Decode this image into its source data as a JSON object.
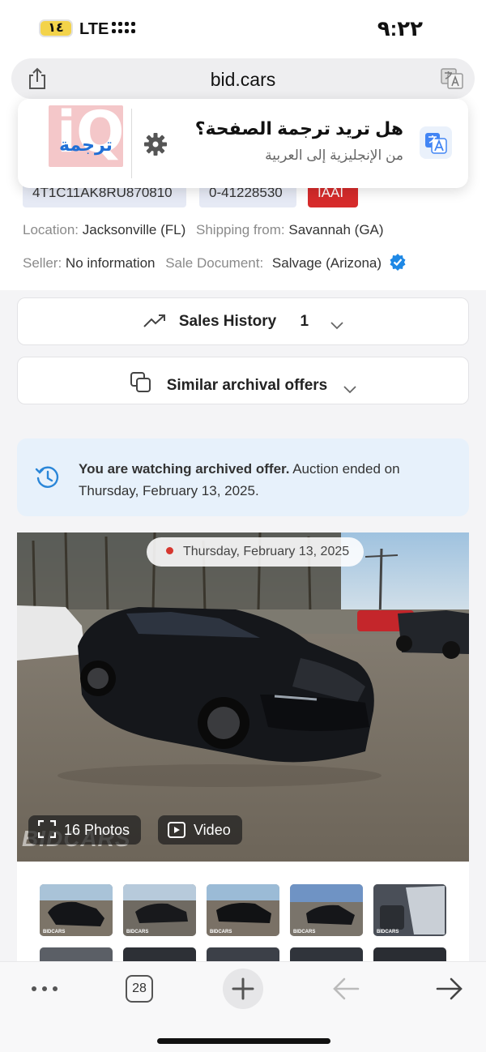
{
  "status_bar": {
    "battery_level": "١٤",
    "network": "LTE",
    "time": "٩:٢٢"
  },
  "browser": {
    "url": "bid.cars",
    "tab_count": "28"
  },
  "translate_banner": {
    "logo_text": "ترجمة",
    "prompt": "هل تريد ترجمة الصفحة؟",
    "language_pair": "من الإنجليزية إلى العربية"
  },
  "vehicle": {
    "vin": "4T1C11AK8RU870810",
    "lot": "0-41228530",
    "auction": "IAAI",
    "location_label": "Location:",
    "location": "Jacksonville (FL)",
    "shipping_label": "Shipping from:",
    "shipping": "Savannah (GA)",
    "seller_label": "Seller:",
    "seller": "No information",
    "document_label": "Sale Document:",
    "document": "Salvage (Arizona)"
  },
  "sections": {
    "sales_history_label": "Sales History",
    "sales_history_count": "1",
    "similar_label": "Similar archival offers"
  },
  "notice": {
    "bold": "You are watching archived offer.",
    "rest": " Auction ended on Thursday, February 13, 2025."
  },
  "gallery": {
    "date": "Thursday, February 13, 2025",
    "photos_label": "16 Photos",
    "video_label": "Video",
    "watermark": "BIDCARS",
    "thumb_label": "BIDCARS"
  },
  "colors": {
    "accent_blue": "#1a73e8",
    "auction_red": "#d62b2b",
    "notice_bg": "#e7f1fb"
  }
}
